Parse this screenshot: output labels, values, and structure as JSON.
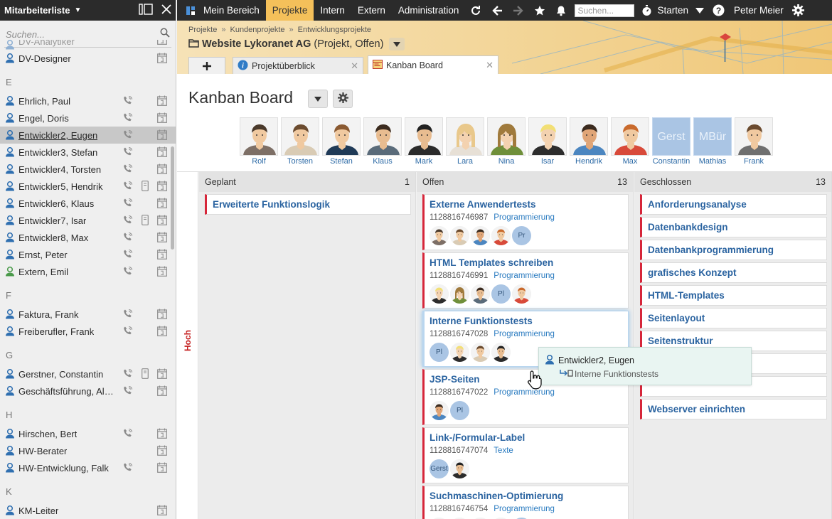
{
  "sidebar": {
    "title": "Mitarbeiterliste",
    "search_placeholder": "Suchen...",
    "top_partial": "DV-Analytiker",
    "groups": [
      {
        "letter": "",
        "items": [
          {
            "name": "DV-Designer",
            "phone": false,
            "mobile": false,
            "ext": false
          }
        ]
      },
      {
        "letter": "E",
        "items": [
          {
            "name": "Ehrlich, Paul",
            "phone": true,
            "mobile": false,
            "ext": false
          },
          {
            "name": "Engel, Doris",
            "phone": true,
            "mobile": false,
            "ext": false
          },
          {
            "name": "Entwickler2, Eugen",
            "phone": true,
            "mobile": false,
            "ext": false,
            "selected": true
          },
          {
            "name": "Entwickler3, Stefan",
            "phone": true,
            "mobile": false,
            "ext": false
          },
          {
            "name": "Entwickler4, Torsten",
            "phone": true,
            "mobile": false,
            "ext": false
          },
          {
            "name": "Entwickler5, Hendrik",
            "phone": true,
            "mobile": true,
            "ext": false
          },
          {
            "name": "Entwickler6, Klaus",
            "phone": true,
            "mobile": false,
            "ext": false
          },
          {
            "name": "Entwickler7, Isar",
            "phone": true,
            "mobile": true,
            "ext": false
          },
          {
            "name": "Entwickler8, Max",
            "phone": true,
            "mobile": false,
            "ext": false
          },
          {
            "name": "Ernst, Peter",
            "phone": true,
            "mobile": false,
            "ext": false
          },
          {
            "name": "Extern, Emil",
            "phone": true,
            "mobile": false,
            "ext": true
          }
        ]
      },
      {
        "letter": "F",
        "items": [
          {
            "name": "Faktura, Frank",
            "phone": true,
            "mobile": false,
            "ext": false
          },
          {
            "name": "Freiberufler, Frank",
            "phone": true,
            "mobile": false,
            "ext": false
          }
        ]
      },
      {
        "letter": "G",
        "items": [
          {
            "name": "Gerstner, Constantin",
            "phone": true,
            "mobile": true,
            "ext": false
          },
          {
            "name": "Geschäftsführung, Ale...",
            "phone": true,
            "mobile": false,
            "ext": false
          }
        ]
      },
      {
        "letter": "H",
        "items": [
          {
            "name": "Hirschen, Bert",
            "phone": true,
            "mobile": false,
            "ext": false
          },
          {
            "name": "HW-Berater",
            "phone": false,
            "mobile": false,
            "ext": false
          },
          {
            "name": "HW-Entwicklung, Falk",
            "phone": true,
            "mobile": false,
            "ext": false
          }
        ]
      },
      {
        "letter": "K",
        "items": [
          {
            "name": "KM-Leiter",
            "phone": false,
            "mobile": false,
            "ext": false
          }
        ]
      }
    ]
  },
  "topbar": {
    "items": [
      {
        "label": "Mein Bereich",
        "active": false
      },
      {
        "label": "Projekte",
        "active": true
      },
      {
        "label": "Intern",
        "active": false
      },
      {
        "label": "Extern",
        "active": false
      },
      {
        "label": "Administration",
        "active": false
      }
    ],
    "search_placeholder": "Suchen...",
    "start_label": "Starten",
    "user_name": "Peter Meier"
  },
  "header": {
    "breadcrumb": [
      "Projekte",
      "Kundenprojekte",
      "Entwicklungsprojekte"
    ],
    "breadcrumb_sep": "»",
    "project_name": "Website Lykoranet AG",
    "project_meta": "(Projekt, Offen)",
    "tabs": [
      {
        "label": "Projektüberblick",
        "active": false
      },
      {
        "label": "Kanban Board",
        "active": true
      }
    ]
  },
  "board": {
    "title": "Kanban Board",
    "priority_label": "Hoch",
    "people": [
      {
        "label": "Rolf",
        "hair": "#4a3a2c",
        "shirt": "#7d6f66",
        "skin": "#f0c9a0",
        "fem": false
      },
      {
        "label": "Torsten",
        "hair": "#6b4b2f",
        "shirt": "#d9cbb4",
        "skin": "#f0c9a0",
        "fem": false
      },
      {
        "label": "Stefan",
        "hair": "#8a5a32",
        "shirt": "#1f3a57",
        "skin": "#f0c9a0",
        "fem": false
      },
      {
        "label": "Klaus",
        "hair": "#3b2b1f",
        "shirt": "#5a6b7a",
        "skin": "#e8bc90",
        "fem": false
      },
      {
        "label": "Mark",
        "hair": "#222222",
        "shirt": "#2b2b2b",
        "skin": "#e8bc90",
        "fem": false
      },
      {
        "label": "Lara",
        "hair": "#e9c88b",
        "shirt": "#e7e0d6",
        "skin": "#f3d2b0",
        "fem": true
      },
      {
        "label": "Nina",
        "hair": "#a07a3c",
        "shirt": "#6f8f3a",
        "skin": "#f3d2b0",
        "fem": true
      },
      {
        "label": "Isar",
        "hair": "#f2df75",
        "shirt": "#2d2d2d",
        "skin": "#f3d2b0",
        "fem": false
      },
      {
        "label": "Hendrik",
        "hair": "#3b2b1f",
        "shirt": "#4c86c0",
        "skin": "#e0a577",
        "fem": false
      },
      {
        "label": "Max",
        "hair": "#c96a2c",
        "shirt": "#d84a3a",
        "skin": "#f0c9a0",
        "fem": false
      },
      {
        "label": "Constantin",
        "initials": "Gerst"
      },
      {
        "label": "Mathias",
        "initials": "MBür"
      },
      {
        "label": "Frank",
        "hair": "#6b4b2f",
        "shirt": "#6f6f6f",
        "skin": "#f0c9a0",
        "fem": false
      }
    ],
    "columns": [
      {
        "name": "Geplant",
        "count": "1",
        "cards": [
          {
            "title": "Erweiterte Funktionslogik"
          }
        ]
      },
      {
        "name": "Offen",
        "count": "13",
        "cards": [
          {
            "title": "Externe Anwendertests",
            "id": "1128816746987",
            "tag": "Programmierung",
            "avatars": [
              "Rolf",
              "Torsten",
              "Hendrik",
              "Max",
              "Pr"
            ]
          },
          {
            "title": "HTML Templates schreiben",
            "id": "1128816746991",
            "tag": "Programmierung",
            "avatars": [
              "Isar",
              "Nina",
              "Klaus",
              "Pl",
              "Max"
            ]
          },
          {
            "title": "Interne Funktionstests",
            "id": "1128816747028",
            "tag": "Programmierung",
            "avatars": [
              "Pl",
              "Isar",
              "Torsten",
              "Mark"
            ],
            "highlight": true
          },
          {
            "title": "JSP-Seiten",
            "id": "1128816747022",
            "tag": "Programmierung",
            "avatars": [
              "Hendrik",
              "Pl"
            ]
          },
          {
            "title": "Link-/Formular-Label",
            "id": "1128816747074",
            "tag": "Texte",
            "avatars": [
              "Gerst",
              "Mark"
            ]
          },
          {
            "title": "Suchmaschinen-Optimierung",
            "id": "1128816746754",
            "tag": "Programmierung",
            "avatars": [
              "Max",
              "Mark",
              "Rolf",
              "Isar",
              "Pl"
            ]
          }
        ]
      },
      {
        "name": "Geschlossen",
        "count": "13",
        "cards": [
          {
            "title": "Anforderungsanalyse"
          },
          {
            "title": "Datenbankdesign"
          },
          {
            "title": "Datenbankprogrammierung"
          },
          {
            "title": "grafisches Konzept"
          },
          {
            "title": "HTML-Templates"
          },
          {
            "title": "Seitenlayout"
          },
          {
            "title": "Seitenstruktur"
          },
          {
            "title": ""
          },
          {
            "title": ""
          },
          {
            "title": "Webserver einrichten"
          }
        ]
      }
    ]
  },
  "drag_tooltip": {
    "person": "Entwickler2, Eugen",
    "target": "Interne Funktionstests"
  },
  "colors": {
    "dark_bar": "#2b2b2b",
    "active_tab": "#f4c05a",
    "link_blue": "#2a63a0",
    "priority_red": "#d6263a"
  }
}
